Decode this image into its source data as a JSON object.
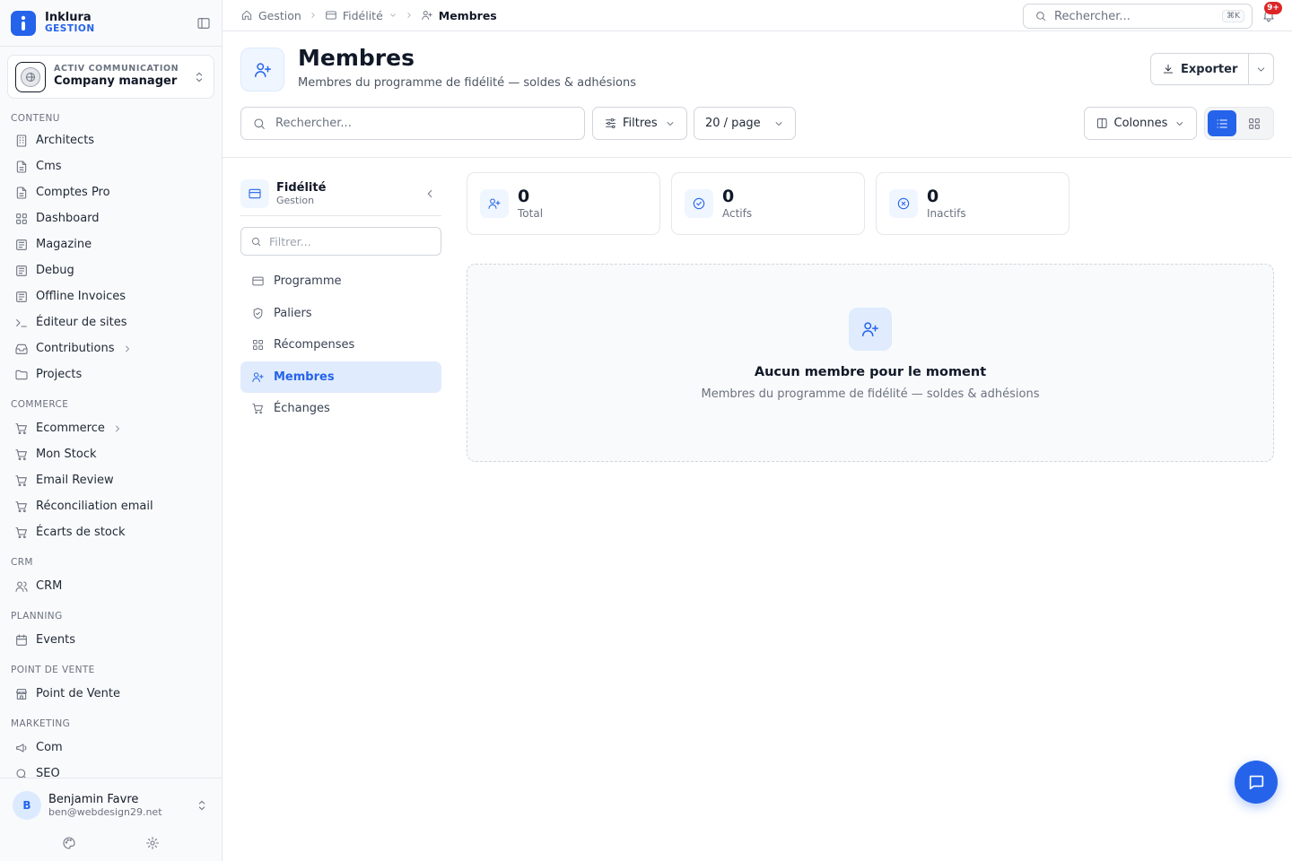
{
  "brand": {
    "name": "Inklura",
    "sub": "GESTION"
  },
  "org": {
    "label": "ACTIV COMMUNICATION",
    "name": "Company manager"
  },
  "nav": {
    "sections": {
      "contenu": "CONTENU",
      "commerce": "COMMERCE",
      "crm": "CRM",
      "planning": "PLANNING",
      "pos": "POINT DE VENTE",
      "marketing": "MARKETING"
    },
    "contenu": [
      "Architects",
      "Cms",
      "Comptes Pro",
      "Dashboard",
      "Magazine",
      "Debug",
      "Offline Invoices",
      "Éditeur de sites",
      "Contributions",
      "Projects"
    ],
    "commerce": [
      "Ecommerce",
      "Mon Stock",
      "Email Review",
      "Réconciliation email",
      "Écarts de stock"
    ],
    "crm": [
      "CRM"
    ],
    "planning": [
      "Events"
    ],
    "pos": [
      "Point de Vente"
    ],
    "marketing": [
      "Com",
      "SEO"
    ]
  },
  "user": {
    "initial": "B",
    "name": "Benjamin Favre",
    "email": "ben@webdesign29.net"
  },
  "breadcrumb": {
    "home": "Gestion",
    "section": "Fidélité",
    "current": "Membres"
  },
  "topbar": {
    "search_placeholder": "Rechercher...",
    "shortcut": "⌘K",
    "notif_count": "9+"
  },
  "page": {
    "title": "Membres",
    "subtitle": "Membres du programme de fidélité — soldes & adhésions",
    "export_label": "Exporter"
  },
  "toolbar": {
    "search_placeholder": "Rechercher...",
    "filters_label": "Filtres",
    "page_size_label": "20 / page",
    "columns_label": "Colonnes"
  },
  "subnav": {
    "title": "Fidélité",
    "sub": "Gestion",
    "filter_placeholder": "Filtrer...",
    "items": [
      "Programme",
      "Paliers",
      "Récompenses",
      "Membres",
      "Échanges"
    ],
    "active": "Membres"
  },
  "stats": [
    {
      "value": "0",
      "label": "Total"
    },
    {
      "value": "0",
      "label": "Actifs"
    },
    {
      "value": "0",
      "label": "Inactifs"
    }
  ],
  "empty": {
    "title": "Aucun membre pour le moment",
    "subtitle": "Membres du programme de fidélité — soldes & adhésions"
  },
  "colors": {
    "accent": "#2563eb",
    "badge": "#dc2626"
  }
}
